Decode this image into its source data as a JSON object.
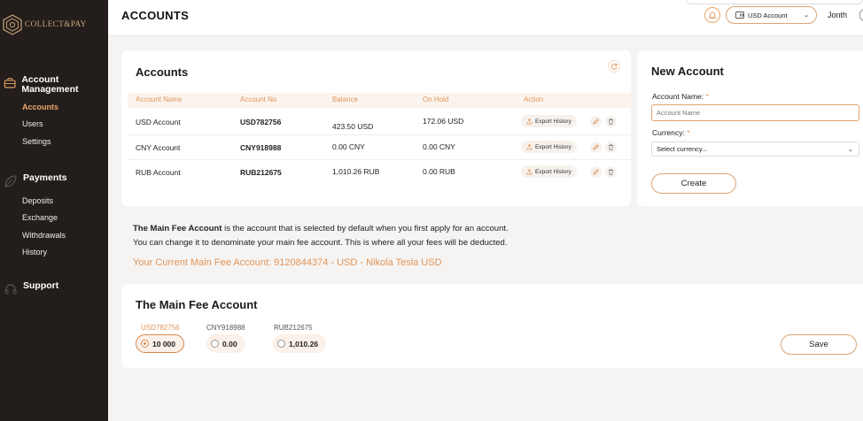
{
  "brand": {
    "name": "COLLECT&PAY"
  },
  "sidebar": {
    "sections": [
      {
        "title": "Account Management",
        "icon": "briefcase-icon",
        "items": [
          {
            "label": "Accounts",
            "active": true
          },
          {
            "label": "Users"
          },
          {
            "label": "Settings"
          }
        ]
      },
      {
        "title": "Payments",
        "icon": "leaf-icon",
        "items": [
          {
            "label": "Deposits"
          },
          {
            "label": "Exchange"
          },
          {
            "label": "Withdrawals"
          },
          {
            "label": "History"
          }
        ]
      },
      {
        "title": "Support",
        "icon": "headset-icon",
        "items": []
      }
    ]
  },
  "header": {
    "title": "ACCOUNTS",
    "account_selector": "USD Account",
    "user": "Jonth"
  },
  "accounts": {
    "title": "Accounts",
    "columns": [
      "Account Name",
      "Account No",
      "Balance",
      "On Hold",
      "Action"
    ],
    "rows": [
      {
        "name": "USD Account",
        "number": "USD782756",
        "balance": "423.50 USD",
        "on_hold": "172.06 USD"
      },
      {
        "name": "CNY Account",
        "number": "CNY918988",
        "balance": "0.00 CNY",
        "on_hold": "0.00 CNY"
      },
      {
        "name": "RUB Account",
        "number": "RUB212675",
        "balance": "1,010.26 RUB",
        "on_hold": "0.00 RUB"
      }
    ],
    "export_label": "Export History"
  },
  "new_account": {
    "title": "New Account",
    "name_label": "Account Name:",
    "required_mark": "*",
    "name_placeholder": "Account Name",
    "currency_label": "Currency:",
    "currency_value": "Select currency...",
    "create_label": "Create"
  },
  "info": {
    "line1_bold": "The Main Fee Account",
    "line1_rest": " is the account that is selected by default when you first apply for an account.",
    "line2": "You can change it to denominate your main fee account. This is where all your fees will be deducted.",
    "current": "Your Current Main Fee Account: 9120844374 - USD - Nikola Tesla USD"
  },
  "main_fee": {
    "title": "The Main Fee Account",
    "options": [
      {
        "label": "USD782756",
        "value": "10 000",
        "selected": true
      },
      {
        "label": "CNY918988",
        "value": "0.00",
        "selected": false
      },
      {
        "label": "RUB212675",
        "value": "1,010.26",
        "selected": false
      }
    ],
    "save_label": "Save"
  },
  "colors": {
    "accent": "#e0955b",
    "sidebar": "#231e1b"
  }
}
